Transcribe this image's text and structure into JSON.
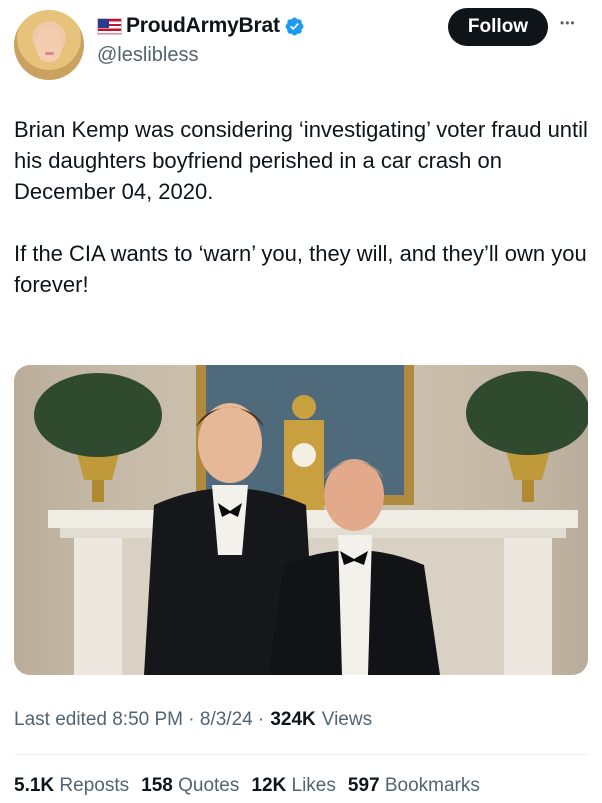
{
  "author": {
    "display_name": "ProudArmyBrat",
    "handle": "@leslibless",
    "verified": true,
    "flag": "us-flag-icon"
  },
  "follow_label": "Follow",
  "more_label": "•••",
  "tweet": {
    "paragraphs": [
      "Brian Kemp was considering ‘investigating’ voter fraud until his daughters boyfriend perished in a car crash on December 04, 2020.",
      "If the CIA wants to ‘warn’ you, they will, and they’ll own you forever!"
    ]
  },
  "meta": {
    "edited_label": "Last edited 8:50 PM · 8/3/24 ·",
    "views_count": "324K",
    "views_label": "Views"
  },
  "stats": {
    "reposts": {
      "count": "5.1K",
      "label": "Reposts"
    },
    "quotes": {
      "count": "158",
      "label": "Quotes"
    },
    "likes": {
      "count": "12K",
      "label": "Likes"
    },
    "bookmarks": {
      "count": "597",
      "label": "Bookmarks"
    }
  },
  "colors": {
    "text": "#0f1419",
    "secondary": "#536471",
    "verified": "#1d9bf0",
    "follow_bg": "#0f1419"
  }
}
